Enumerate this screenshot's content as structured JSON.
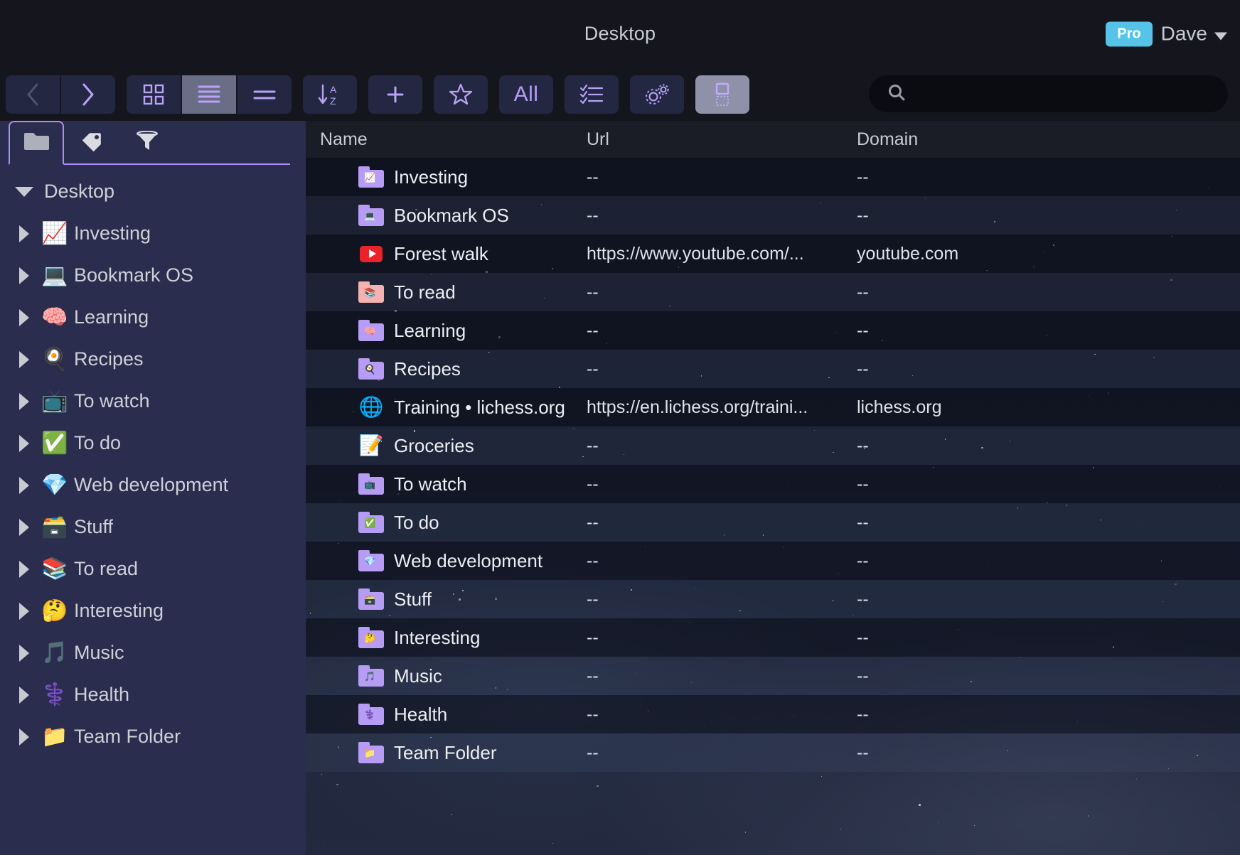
{
  "titlebar": {
    "title": "Desktop",
    "pro_badge": "Pro",
    "user": "Dave"
  },
  "toolbar": {
    "back_label": "‹",
    "forward_label": "›",
    "all_label": "All",
    "buttons": [
      {
        "name": "back",
        "icon": "chevron-left-icon"
      },
      {
        "name": "forward",
        "icon": "chevron-right-icon"
      },
      {
        "name": "grid-view",
        "icon": "grid-view-icon"
      },
      {
        "name": "list-view",
        "icon": "list-view-icon"
      },
      {
        "name": "compact-view",
        "icon": "compact-view-icon"
      },
      {
        "name": "sort",
        "icon": "sort-az-icon"
      },
      {
        "name": "add",
        "icon": "plus-icon"
      },
      {
        "name": "favorites",
        "icon": "star-icon"
      },
      {
        "name": "all-filter",
        "icon": "all-label"
      },
      {
        "name": "checklist",
        "icon": "checklist-icon"
      },
      {
        "name": "settings",
        "icon": "gears-icon"
      },
      {
        "name": "panel-toggle",
        "icon": "panel-toggle-icon"
      }
    ]
  },
  "search": {
    "value": "",
    "placeholder": ""
  },
  "sidebar": {
    "tabs": [
      {
        "name": "folders",
        "icon": "folder-icon",
        "active": true
      },
      {
        "name": "tags",
        "icon": "tag-icon",
        "active": false
      },
      {
        "name": "filters",
        "icon": "funnel-icon",
        "active": false
      }
    ],
    "root": {
      "label": "Desktop",
      "expanded": true
    },
    "items": [
      {
        "label": "Investing",
        "emoji": "📈"
      },
      {
        "label": "Bookmark OS",
        "emoji": "💻"
      },
      {
        "label": "Learning",
        "emoji": "🧠"
      },
      {
        "label": "Recipes",
        "emoji": "🍳"
      },
      {
        "label": "To watch",
        "emoji": "📺"
      },
      {
        "label": "To do",
        "emoji": "✅"
      },
      {
        "label": "Web development",
        "emoji": "💎"
      },
      {
        "label": "Stuff",
        "emoji": "🗃️"
      },
      {
        "label": "To read",
        "emoji": "📚"
      },
      {
        "label": "Interesting",
        "emoji": "🤔"
      },
      {
        "label": "Music",
        "emoji": "🎵"
      },
      {
        "label": "Health",
        "emoji": "⚕️"
      },
      {
        "label": "Team Folder",
        "emoji": "📁"
      }
    ]
  },
  "table": {
    "columns": [
      "Name",
      "Url",
      "Domain"
    ],
    "empty_value": "--",
    "rows": [
      {
        "name": "Investing",
        "url": "--",
        "domain": "--",
        "icon": "folder-purple",
        "badge": "📈"
      },
      {
        "name": "Bookmark OS",
        "url": "--",
        "domain": "--",
        "icon": "folder-purple",
        "badge": "💻"
      },
      {
        "name": "Forest walk",
        "url": "https://www.youtube.com/...",
        "domain": "youtube.com",
        "icon": "youtube",
        "badge": ""
      },
      {
        "name": "To read",
        "url": "--",
        "domain": "--",
        "icon": "folder-pink",
        "badge": "📚"
      },
      {
        "name": "Learning",
        "url": "--",
        "domain": "--",
        "icon": "folder-purple",
        "badge": "🧠"
      },
      {
        "name": "Recipes",
        "url": "--",
        "domain": "--",
        "icon": "folder-purple",
        "badge": "🍳"
      },
      {
        "name": "Training • lichess.org",
        "url": "https://en.lichess.org/traini...",
        "domain": "lichess.org",
        "icon": "globe",
        "badge": ""
      },
      {
        "name": "Groceries",
        "url": "--",
        "domain": "--",
        "icon": "note",
        "badge": ""
      },
      {
        "name": "To watch",
        "url": "--",
        "domain": "--",
        "icon": "folder-purple",
        "badge": "📺"
      },
      {
        "name": "To do",
        "url": "--",
        "domain": "--",
        "icon": "folder-purple",
        "badge": "✅"
      },
      {
        "name": "Web development",
        "url": "--",
        "domain": "--",
        "icon": "folder-purple",
        "badge": "💎"
      },
      {
        "name": "Stuff",
        "url": "--",
        "domain": "--",
        "icon": "folder-purple",
        "badge": "🗃️"
      },
      {
        "name": "Interesting",
        "url": "--",
        "domain": "--",
        "icon": "folder-purple",
        "badge": "🤔"
      },
      {
        "name": "Music",
        "url": "--",
        "domain": "--",
        "icon": "folder-purple",
        "badge": "🎵"
      },
      {
        "name": "Health",
        "url": "--",
        "domain": "--",
        "icon": "folder-purple",
        "badge": "⚕️"
      },
      {
        "name": "Team Folder",
        "url": "--",
        "domain": "--",
        "icon": "folder-purple",
        "badge": "📁"
      }
    ]
  },
  "colors": {
    "accent_purple": "#b18cf5",
    "pro_badge_blue": "#55c4e8",
    "sidebar_bg": "#2b2d4e",
    "toolbar_btn": "#242742"
  }
}
